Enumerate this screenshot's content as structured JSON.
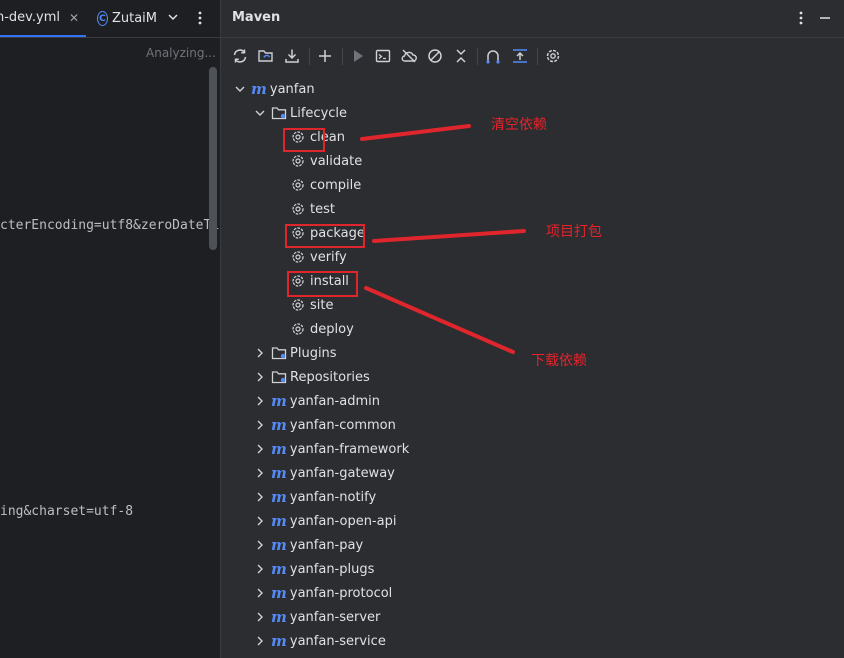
{
  "editor": {
    "tabs": [
      {
        "label": "n-dev.yml",
        "close": "✕"
      },
      {
        "label": "ZutaiM"
      }
    ],
    "status": "Analyzing...",
    "code_lines": [
      {
        "text": "cterEncoding=utf8&zeroDateTi"
      },
      {
        "text": "ing&charset=utf-8"
      }
    ]
  },
  "maven": {
    "title": "Maven",
    "toolbar_icons": [
      "reload-icon",
      "reload-generate-icon",
      "download-icon",
      "add-icon",
      "run-icon",
      "execute-goal-icon",
      "offline-icon",
      "skip-tests-icon",
      "collapse-icon",
      "show-dependencies-icon",
      "expand-icon",
      "settings-icon"
    ],
    "tree": {
      "root": "yanfan",
      "lifecycle_label": "Lifecycle",
      "lifecycle": [
        "clean",
        "validate",
        "compile",
        "test",
        "package",
        "verify",
        "install",
        "site",
        "deploy"
      ],
      "plugins_label": "Plugins",
      "repositories_label": "Repositories",
      "modules": [
        "yanfan-admin",
        "yanfan-common",
        "yanfan-framework",
        "yanfan-gateway",
        "yanfan-notify",
        "yanfan-open-api",
        "yanfan-pay",
        "yanfan-plugs",
        "yanfan-protocol",
        "yanfan-server",
        "yanfan-service"
      ]
    }
  },
  "annotations": {
    "clean": "清空依赖",
    "package": "项目打包",
    "install": "下载依赖",
    "color": "#e8212a"
  }
}
